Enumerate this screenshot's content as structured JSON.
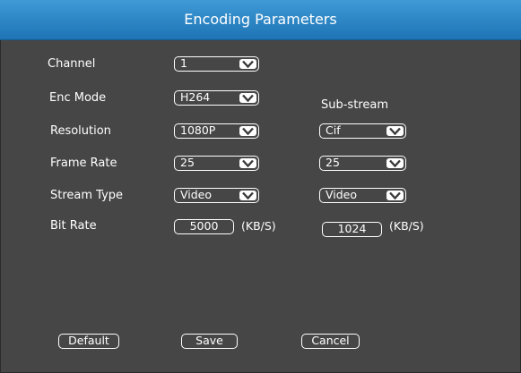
{
  "dialog": {
    "title": "Encoding Parameters"
  },
  "labels": {
    "channel": "Channel",
    "enc_mode": "Enc Mode",
    "resolution": "Resolution",
    "frame_rate": "Frame Rate",
    "stream_type": "Stream Type",
    "bit_rate": "Bit Rate",
    "sub_stream": "Sub-stream"
  },
  "main_stream": {
    "channel": "1",
    "enc_mode": "H264",
    "resolution": "1080P",
    "frame_rate": "25",
    "stream_type": "Video",
    "bit_rate": "5000",
    "bit_rate_unit": "(KB/S)"
  },
  "sub_stream": {
    "resolution": "Cif",
    "frame_rate": "25",
    "stream_type": "Video",
    "bit_rate": "1024",
    "bit_rate_unit": "(KB/S)"
  },
  "buttons": {
    "default": "Default",
    "save": "Save",
    "cancel": "Cancel"
  },
  "icons": {
    "dropdown": "chevron-down-icon"
  },
  "colors": {
    "title_bar": "#2a86c8",
    "background": "#464646",
    "text": "#ffffff"
  }
}
